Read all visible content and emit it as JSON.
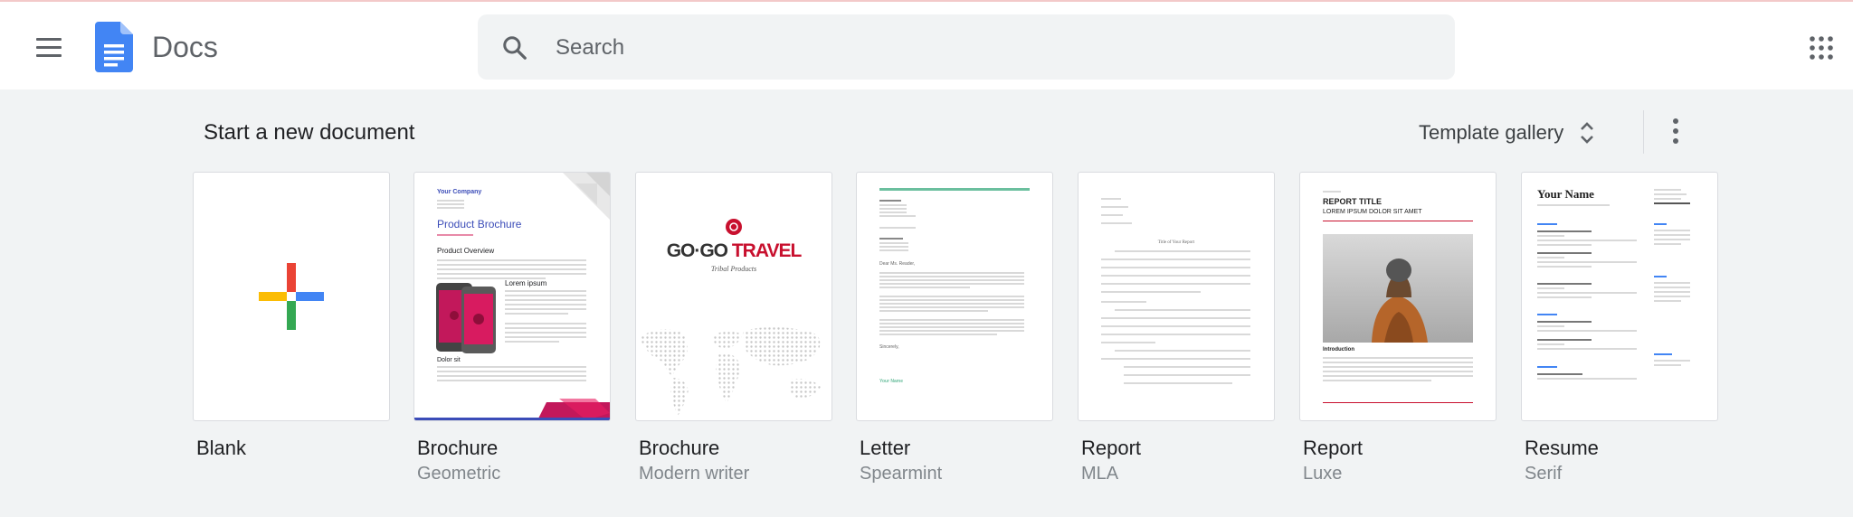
{
  "header": {
    "app_title": "Docs",
    "search_placeholder": "Search"
  },
  "section": {
    "title": "Start a new document",
    "gallery_label": "Template gallery"
  },
  "templates": [
    {
      "name": "Blank",
      "subtitle": ""
    },
    {
      "name": "Brochure",
      "subtitle": "Geometric"
    },
    {
      "name": "Brochure",
      "subtitle": "Modern writer"
    },
    {
      "name": "Letter",
      "subtitle": "Spearmint"
    },
    {
      "name": "Report",
      "subtitle": "MLA"
    },
    {
      "name": "Report",
      "subtitle": "Luxe"
    },
    {
      "name": "Resume",
      "subtitle": "Serif"
    }
  ],
  "thumbs": {
    "geometric": {
      "company": "Your Company",
      "title": "Product Brochure",
      "overview": "Product Overview",
      "lorem": "Lorem ipsum",
      "dolor": "Dolor sit"
    },
    "modern_writer": {
      "brand_a": "GO·GO ",
      "brand_b": "TRAVEL",
      "tagline": "Tribal Products"
    },
    "spearmint": {
      "greeting": "Dear Ms. Reader,",
      "signoff": "Sincerely,",
      "name": "Your Name"
    },
    "mla": {
      "title": "Title of Your Report"
    },
    "luxe": {
      "title": "REPORT TITLE",
      "subtitle": "LOREM IPSUM DOLOR SIT AMET",
      "intro": "Introduction"
    },
    "resume": {
      "name": "Your Name"
    }
  },
  "colors": {
    "docs_blue": "#4285f4",
    "accent_red": "#c8102e",
    "brochure_blue": "#3b4cb8",
    "brochure_pink": "#c2185b",
    "spearmint_green": "#6bbf9e"
  },
  "icons": {
    "menu": "menu-icon",
    "search": "search-icon",
    "apps": "apps-grid-icon",
    "gallery": "unfold-more-icon",
    "more": "more-vert-icon",
    "blank": "plus-icon"
  }
}
